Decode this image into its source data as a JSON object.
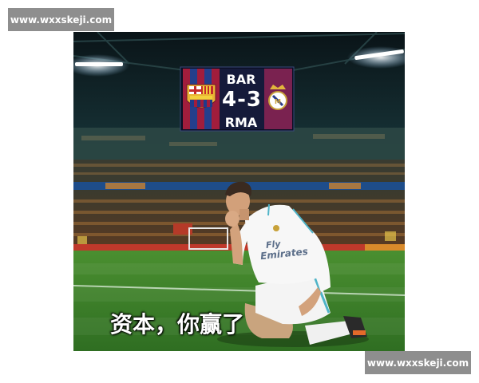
{
  "watermark": {
    "top_text": "www.wxxskeji.com",
    "bottom_text": "www.wxxskeji.com"
  },
  "scoreboard": {
    "home_team": "BAR",
    "score": "4-3",
    "away_team": "RMA"
  },
  "caption": "资本，你赢了",
  "jersey": {
    "sponsor_line1": "Fly",
    "sponsor_line2": "Emirates"
  },
  "colors": {
    "barca_blue": "#1f3f8f",
    "barca_red": "#a31d3d",
    "madrid_purple": "#7a2250",
    "pitch_green": "#3f8a2c",
    "watermark_gray": "#8e8e8e"
  }
}
